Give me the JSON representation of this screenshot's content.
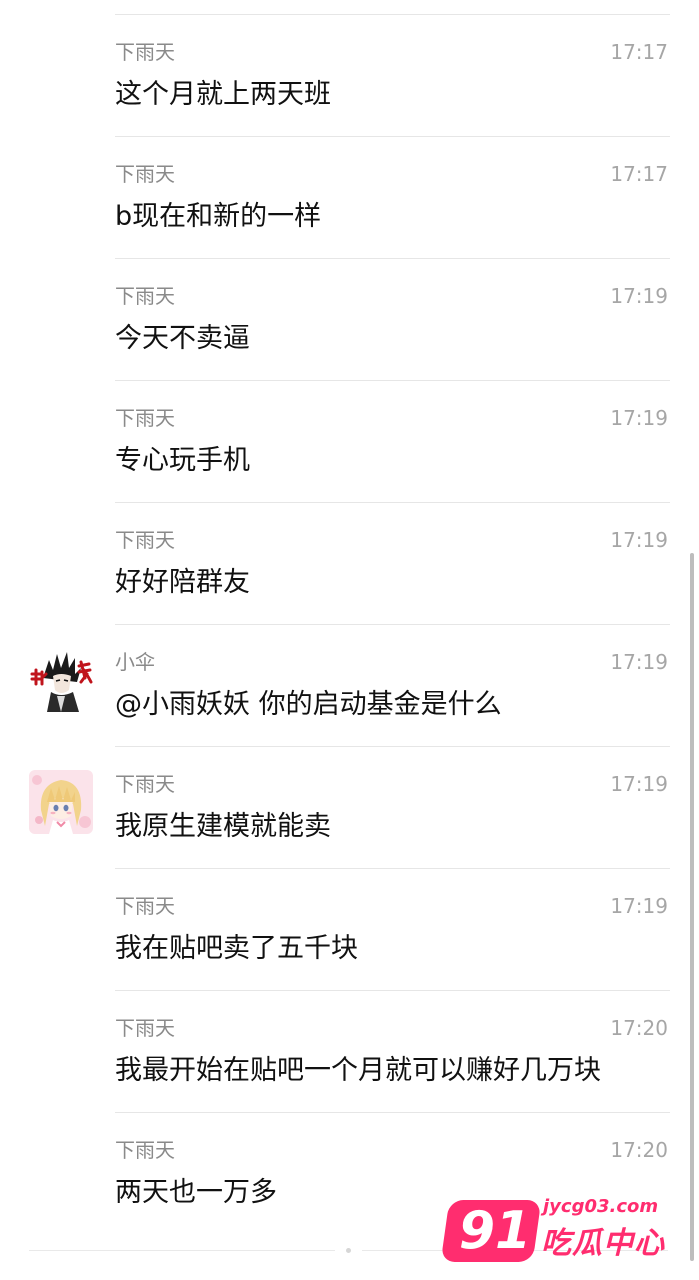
{
  "messages": [
    {
      "sender": "下雨天",
      "time": "17:17",
      "text": "这个月就上两天班",
      "avatar": ""
    },
    {
      "sender": "下雨天",
      "time": "17:17",
      "text": "b现在和新的一样",
      "avatar": ""
    },
    {
      "sender": "下雨天",
      "time": "17:19",
      "text": "今天不卖逼",
      "avatar": ""
    },
    {
      "sender": "下雨天",
      "time": "17:19",
      "text": "专心玩手机",
      "avatar": ""
    },
    {
      "sender": "下雨天",
      "time": "17:19",
      "text": "好好陪群友",
      "avatar": ""
    },
    {
      "sender": "小伞",
      "time": "17:19",
      "text": "@小雨妖妖 你的启动基金是什么",
      "avatar": "manga-character-avatar"
    },
    {
      "sender": "下雨天",
      "time": "17:19",
      "text": "我原生建模就能卖",
      "avatar": "anime-girl-avatar"
    },
    {
      "sender": "下雨天",
      "time": "17:19",
      "text": "我在贴吧卖了五千块",
      "avatar": ""
    },
    {
      "sender": "下雨天",
      "time": "17:20",
      "text": "我最开始在贴吧一个月就可以赚好几万块",
      "avatar": ""
    },
    {
      "sender": "下雨天",
      "time": "17:20",
      "text": "两天也一万多",
      "avatar": ""
    }
  ],
  "watermark": {
    "number": "91",
    "domain": "jycg03.com",
    "name": "吃瓜中心",
    "color": "#ff2d6f"
  }
}
